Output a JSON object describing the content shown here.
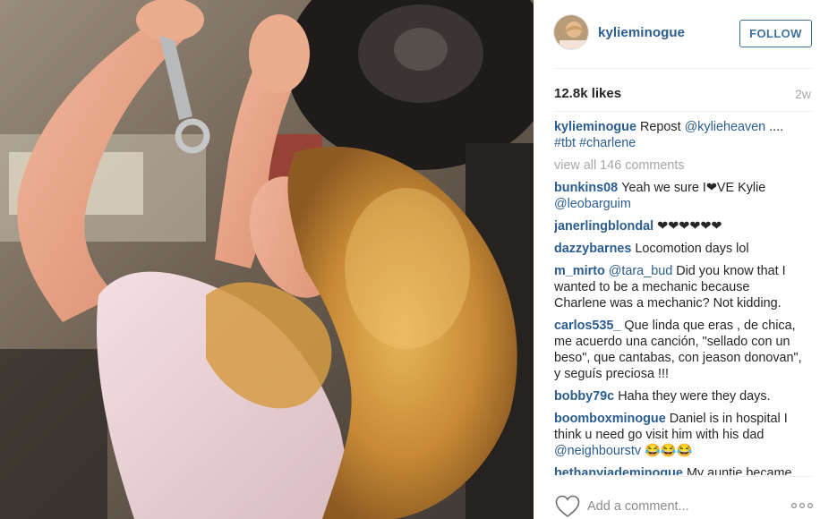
{
  "post": {
    "username": "kylieminogue",
    "follow_label": "FOLLOW",
    "likes": "12.8k likes",
    "time_ago": "2w",
    "caption": {
      "author": "kylieminogue",
      "text_prefix": "Repost ",
      "mention": "@kylieheaven",
      "text_suffix": " ....",
      "hashtags": "#tbt #charlene"
    },
    "view_all_comments": "view all 146 comments",
    "comments": [
      {
        "author": "bunkins08",
        "text": "Yeah we sure I❤VE Kylie ",
        "mention": "@leobarguim",
        "text_after": ""
      },
      {
        "author": "janerlingblondal",
        "text": "❤❤❤❤❤❤",
        "mention": "",
        "text_after": ""
      },
      {
        "author": "dazzybarnes",
        "text": "Locomotion days lol",
        "mention": "",
        "text_after": ""
      },
      {
        "author": "m_mirto",
        "text": "",
        "mention": "@tara_bud",
        "text_after": " Did you know that I wanted to be a mechanic because Charlene was a mechanic? Not kidding."
      },
      {
        "author": "carlos535_",
        "text": "Que linda que eras , de chica, me acuerdo una canción, \"sellado con un beso\", que cantabas, con jeason donovan\", y seguís preciosa !!!",
        "mention": "",
        "text_after": ""
      },
      {
        "author": "bobby79c",
        "text": "Haha they were they days.",
        "mention": "",
        "text_after": ""
      },
      {
        "author": "boomboxminogue",
        "text": "Daniel is in hospital I think u need go visit him with his dad ",
        "mention": "@neighbourstv",
        "text_after": " 😂😂😂"
      },
      {
        "author": "bethanyiademinogue",
        "text": "My auntie became",
        "mention": "",
        "text_after": ""
      }
    ],
    "add_comment_placeholder": "Add a comment...",
    "more_options_icon": "ellipsis-icon",
    "like_icon": "heart-outline-icon"
  },
  "colors": {
    "link": "#2b5d8f",
    "follow_border": "#3f729b",
    "muted": "#a5a7aa",
    "text": "#262626",
    "divider": "#efefef"
  }
}
